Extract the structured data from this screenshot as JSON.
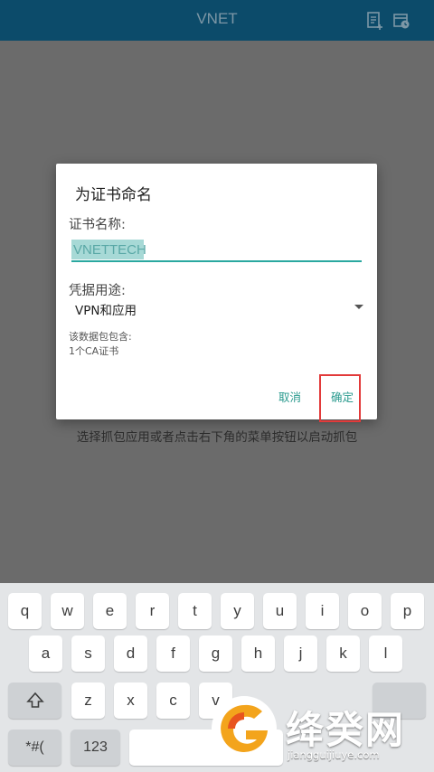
{
  "appbar": {
    "title": "VNET",
    "icons": [
      "document-add-icon",
      "calendar-clock-icon"
    ]
  },
  "content": {
    "hint": "选择抓包应用或者点击右下角的菜单按钮以启动抓包"
  },
  "dialog": {
    "title": "为证书命名",
    "name_label": "证书名称:",
    "name_value": "VNETTECH",
    "usage_label": "凭据用途:",
    "usage_value": "VPN和应用",
    "contains_label": "该数据包包含:",
    "contains_value": "1个CA证书",
    "cancel_label": "取消",
    "ok_label": "确定"
  },
  "keyboard": {
    "row1": [
      "q",
      "w",
      "e",
      "r",
      "t",
      "y",
      "u",
      "i",
      "o",
      "p"
    ],
    "row2": [
      "a",
      "s",
      "d",
      "f",
      "g",
      "h",
      "j",
      "k",
      "l"
    ],
    "row3": [
      "z",
      "x",
      "c",
      "v"
    ],
    "symbols_label": "*#(",
    "numbers_label": "123",
    "shift_icon": "shift-icon"
  },
  "watermark": {
    "name": "绛癸网",
    "url": "jiangguijiuye.com"
  },
  "colors": {
    "appbar": "#0c4b6a",
    "accent": "#2aa8a0",
    "highlight_box": "#e23a3a"
  }
}
